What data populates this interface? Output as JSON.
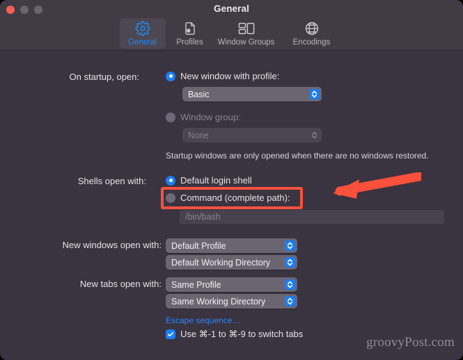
{
  "window": {
    "title": "General",
    "traffic_lights": [
      {
        "name": "close",
        "color": "#fb5f50"
      },
      {
        "name": "minimize",
        "color": "#6a6370"
      },
      {
        "name": "zoom",
        "color": "#6a6370"
      }
    ]
  },
  "toolbar": {
    "items": [
      {
        "label": "General",
        "icon": "gear-icon",
        "selected": true
      },
      {
        "label": "Profiles",
        "icon": "document-gear-icon",
        "selected": false
      },
      {
        "label": "Window Groups",
        "icon": "window-groups-icon",
        "selected": false
      },
      {
        "label": "Encodings",
        "icon": "globe-icon",
        "selected": false
      }
    ],
    "selected_color": "#1b8cfa"
  },
  "settings": {
    "on_startup": {
      "label": "On startup, open:",
      "options": [
        {
          "label": "New window with profile:",
          "selected": true,
          "enabled": true
        },
        {
          "label": "Window group:",
          "selected": false,
          "enabled": false
        }
      ],
      "profile_popup": {
        "value": "Basic",
        "enabled": true
      },
      "group_popup": {
        "value": "None",
        "enabled": false
      },
      "note": "Startup windows are only opened when there are no windows restored."
    },
    "shells_open_with": {
      "label": "Shells open with:",
      "options": [
        {
          "label": "Default login shell",
          "selected": true,
          "enabled": true
        },
        {
          "label": "Command (complete path):",
          "selected": false,
          "enabled": true
        }
      ],
      "command_field": {
        "value": "/bin/bash",
        "enabled": false
      }
    },
    "new_windows_open_with": {
      "label": "New windows open with:",
      "profile_popup": {
        "value": "Default Profile"
      },
      "directory_popup": {
        "value": "Default Working Directory"
      }
    },
    "new_tabs_open_with": {
      "label": "New tabs open with:",
      "profile_popup": {
        "value": "Same Profile"
      },
      "directory_popup": {
        "value": "Same Working Directory"
      }
    },
    "escape_sequence_link": "Escape sequence…",
    "switch_tabs_checkbox": {
      "label": "Use ⌘-1 to ⌘-9 to switch tabs",
      "checked": true
    }
  },
  "annotations": {
    "highlight_color": "#f9513c",
    "highlight_target": "Command (complete path):",
    "arrow_direction": "left"
  },
  "watermark": "groovyPost.com"
}
